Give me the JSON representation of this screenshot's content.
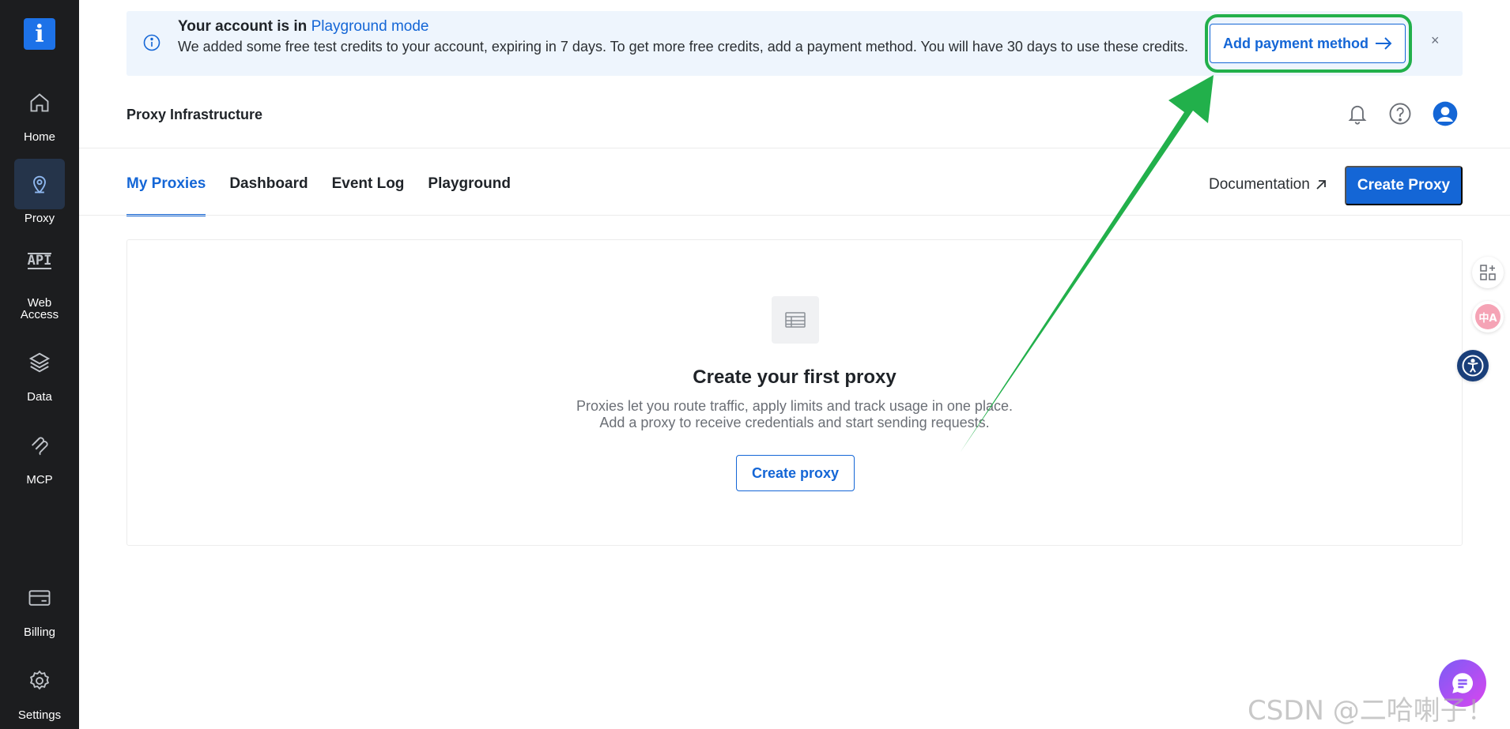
{
  "sidebar": {
    "logo_glyph": "i",
    "items": [
      {
        "label": "Home",
        "icon": "home-icon"
      },
      {
        "label": "Proxy",
        "icon": "location-pin-icon",
        "active": true
      },
      {
        "label": "Web Access",
        "icon": "api-icon",
        "icon_text": "API"
      },
      {
        "label": "Data",
        "icon": "layers-icon"
      },
      {
        "label": "MCP",
        "icon": "mcp-icon"
      },
      {
        "label": "Billing",
        "icon": "billing-card-icon"
      },
      {
        "label": "Settings",
        "icon": "gear-icon"
      }
    ]
  },
  "banner": {
    "title_prefix": "Your account is in ",
    "title_link": "Playground mode",
    "body": "We added some free test credits to your account, expiring in 7 days. To get more free credits, add a payment method. You will have 30 days to use these credits.",
    "action_label": "Add payment method",
    "close_glyph": "×",
    "highlight_color": "#22b04b"
  },
  "header": {
    "title": "Proxy Infrastructure",
    "icons": [
      "bell-icon",
      "help-icon",
      "user-avatar-icon"
    ]
  },
  "tabs": [
    {
      "label": "My Proxies",
      "active": true
    },
    {
      "label": "Dashboard"
    },
    {
      "label": "Event Log"
    },
    {
      "label": "Playground"
    }
  ],
  "actions": {
    "documentation_label": "Documentation",
    "create_proxy_label": "Create Proxy"
  },
  "empty_state": {
    "icon": "table-icon",
    "title": "Create your first proxy",
    "line1": "Proxies let you route traffic, apply limits and track usage in one place.",
    "line2": "Add a proxy to receive credentials and start sending requests.",
    "button_label": "Create proxy"
  },
  "floating": {
    "widgets": [
      "apps-icon",
      "translate-icon",
      "accessibility-icon"
    ],
    "translate_text": "中A",
    "chat": "chat-icon"
  },
  "watermark": "CSDN @二哈喇子！",
  "colors": {
    "accent": "#1466d6",
    "sidebar_bg": "#1c1d1f",
    "banner_bg": "#eef5fd",
    "arrow": "#22b04b"
  }
}
